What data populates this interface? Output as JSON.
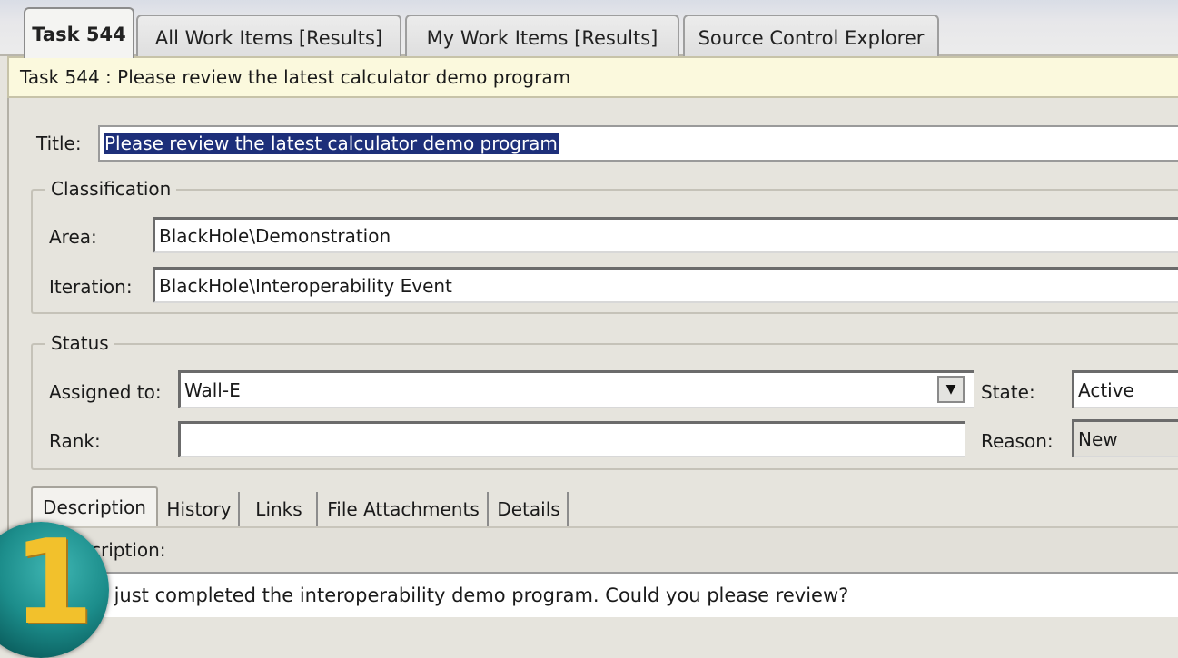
{
  "tabs": [
    {
      "label": "Task 544",
      "active": true
    },
    {
      "label": "All Work Items [Results]",
      "active": false
    },
    {
      "label": "My Work Items [Results]",
      "active": false
    },
    {
      "label": "Source Control Explorer",
      "active": false
    }
  ],
  "caption": "Task 544 : Please review the latest calculator demo program",
  "form": {
    "title_label": "Title:",
    "title_value": "Please review the latest calculator demo program",
    "classification": {
      "legend": "Classification",
      "area_label": "Area:",
      "area_value": "BlackHole\\Demonstration",
      "iteration_label": "Iteration:",
      "iteration_value": "BlackHole\\Interoperability Event"
    },
    "status": {
      "legend": "Status",
      "assigned_label": "Assigned to:",
      "assigned_value": "Wall-E",
      "state_label": "State:",
      "state_value": "Active",
      "rank_label": "Rank:",
      "rank_value": "",
      "reason_label": "Reason:",
      "reason_value": "New"
    }
  },
  "subtabs": [
    {
      "label": "Description",
      "active": true
    },
    {
      "label": "History",
      "active": false
    },
    {
      "label": "Links",
      "active": false
    },
    {
      "label": "File Attachments",
      "active": false
    },
    {
      "label": "Details",
      "active": false
    }
  ],
  "description": {
    "label": "cription:",
    "text": "e just completed the interoperability demo program. Could you please review?"
  },
  "badge": {
    "number": "1"
  },
  "icons": {
    "dropdown": "chevron-down-icon"
  }
}
